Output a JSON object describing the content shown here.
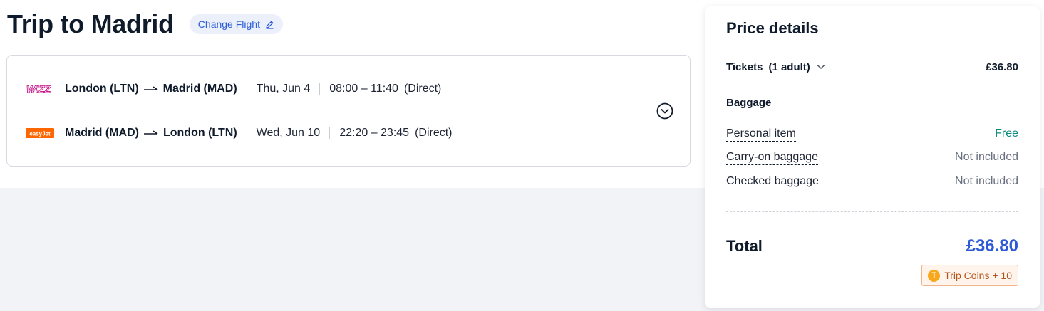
{
  "header": {
    "title": "Trip to Madrid",
    "change_flight_label": "Change Flight"
  },
  "flights": [
    {
      "airline_logo": "wizz-logo",
      "airline_logo_text": "WIZZ",
      "origin": "London (LTN)",
      "destination": "Madrid (MAD)",
      "date": "Thu, Jun 4",
      "times": "08:00 – 11:40",
      "stops": "(Direct)"
    },
    {
      "airline_logo": "easyjet-logo",
      "airline_logo_text": "easyJet",
      "origin": "Madrid (MAD)",
      "destination": "London (LTN)",
      "date": "Wed, Jun 10",
      "times": "22:20 – 23:45",
      "stops": "(Direct)"
    }
  ],
  "price_details": {
    "title": "Price details",
    "tickets_label": "Tickets",
    "tickets_count": "(1 adult)",
    "tickets_price": "£36.80",
    "baggage_heading": "Baggage",
    "baggage": [
      {
        "label": "Personal item",
        "value": "Free"
      },
      {
        "label": "Carry-on baggage",
        "value": "Not included"
      },
      {
        "label": "Checked baggage",
        "value": "Not included"
      }
    ],
    "total_label": "Total",
    "total_value": "£36.80",
    "coins_label": "Trip Coins + 10"
  },
  "colors": {
    "accent": "#2d5bd8",
    "free": "#0a8a78",
    "coin": "#f7a81b"
  }
}
